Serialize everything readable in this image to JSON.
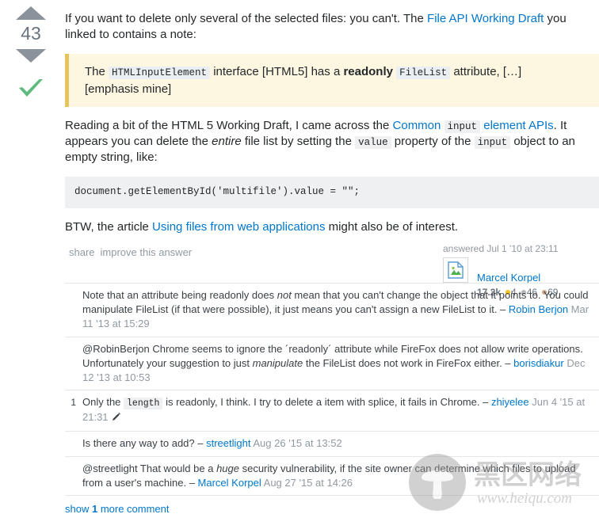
{
  "answer": {
    "vote": {
      "score": "43",
      "upvote_label": "up vote",
      "downvote_label": "down vote",
      "accepted_label": "accepted answer"
    },
    "body": {
      "p1_a": "If you want to delete only several of the selected files: you can't. The ",
      "p1_link": "File API Working Draft",
      "p1_b": " you linked to contains a note:",
      "quote_a": "The ",
      "quote_code1": "HTMLInputElement",
      "quote_b": " interface [HTML5] has a ",
      "quote_bold": "readonly",
      "quote_code2": "FileList",
      "quote_c": " attribute, […]",
      "quote_line2": "[emphasis mine]",
      "p2_a": "Reading a bit of the HTML 5 Working Draft, I came across the ",
      "p2_link1": "Common",
      "p2_code1": "input",
      "p2_link2": "element APIs",
      "p2_b": ". It appears you can delete the ",
      "p2_em": "entire",
      "p2_c": " file list by setting the ",
      "p2_code2": "value",
      "p2_d": " property of the ",
      "p2_code3": "input",
      "p2_e": " object to an empty string, like:",
      "codeblock": "document.getElementById('multifile').value = \"\";",
      "p3_a": "BTW, the article ",
      "p3_link": "Using files from web applications",
      "p3_b": " might also be of interest."
    },
    "post_menu": {
      "share": "share",
      "improve": "improve this answer"
    },
    "user_card": {
      "action_time": "answered Jul 1 '10 at 23:11",
      "avatar_icon": "broken-image-icon",
      "user_name": "Marcel Korpel",
      "reputation": "17.2k",
      "gold": "4",
      "silver": "46",
      "bronze": "69"
    }
  },
  "comments": [
    {
      "score": "",
      "text_a": "Note that an attribute being readonly does ",
      "em": "not",
      "text_b": " mean that you can't change the object that it points to. You could manipulate FileList (if that were possible), it just means you can't assign a new FileList to it. – ",
      "user": "Robin Berjon",
      "date": " Mar 11 '13 at 15:29",
      "has_code": false,
      "has_pencil": false
    },
    {
      "score": "",
      "text_a": "@RobinBerjon Chrome seems to ignore the ´readonly´ attribute while FireFox does not allow write operations. Unfortunately your suggestion to just ",
      "em": "manipulate",
      "text_b": " the FileList does not work in FireFox either. – ",
      "user": "borisdiakur",
      "date": " Dec 12 '13 at 10:53",
      "has_code": false,
      "has_pencil": false
    },
    {
      "score": "1",
      "text_a": "Only the ",
      "code": "length",
      "text_b": " is readonly, I think. I try to delete a item with splice, it fails in Chrome. – ",
      "user": "zhiyelee",
      "date": " Jun 4 '15 at 21:31",
      "has_code": true,
      "has_pencil": true
    },
    {
      "score": "",
      "text_a": "Is there any way to add? – ",
      "user": "streetlight",
      "date": " Aug 26 '15 at 13:52",
      "has_code": false,
      "has_pencil": false
    },
    {
      "score": "",
      "text_a": "@streetlight That would be a ",
      "em": "huge",
      "text_b": " security vulnerability, if the site owner can determine which files to upload from a user's machine. – ",
      "user": "Marcel Korpel",
      "date": " Aug 27 '15 at 14:26",
      "has_code": false,
      "has_pencil": false
    }
  ],
  "show_more": {
    "prefix": "show ",
    "count": "1",
    "suffix": " more comment"
  },
  "watermark": {
    "chinese_text": "黑区网络",
    "url_text": "www.heiqu.com",
    "logo_icon": "mushroom-icon"
  },
  "colors": {
    "link": "#0077cc",
    "accept_green": "#5eba7d",
    "arrow_gray": "#8a939b",
    "quote_bg": "#fdf7e2",
    "quote_border": "#e6c45d",
    "code_bg": "#eff0f1",
    "gold": "#fcc419",
    "silver": "#b4b8bc",
    "bronze": "#d1a684"
  }
}
